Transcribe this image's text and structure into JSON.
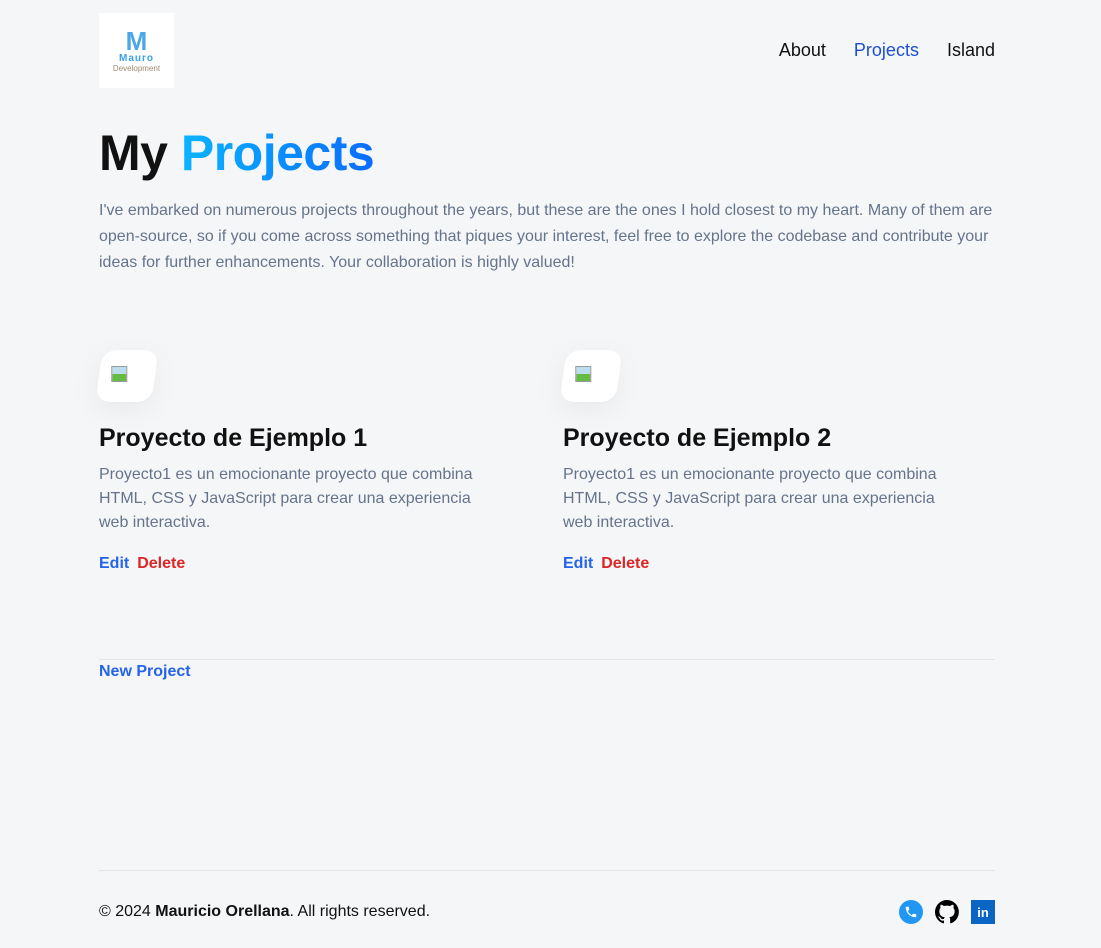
{
  "logo": {
    "mark": "M",
    "line1": "Mauro",
    "line2": "Development"
  },
  "nav": [
    {
      "label": "About"
    },
    {
      "label": "Projects"
    },
    {
      "label": "Island"
    }
  ],
  "title": {
    "prefix": "My",
    "accent": "Projects"
  },
  "intro": "I've embarked on numerous projects throughout the years, but these are the ones I hold closest to my heart. Many of them are open-source, so if you come across something that piques your interest, feel free to explore the codebase and contribute your ideas for further enhancements. Your collaboration is highly valued!",
  "projects": [
    {
      "title": "Proyecto de Ejemplo 1",
      "description": "Proyecto1 es un emocionante proyecto que combina HTML, CSS y JavaScript para crear una experiencia web interactiva.",
      "edit": "Edit",
      "delete": "Delete"
    },
    {
      "title": "Proyecto de Ejemplo 2",
      "description": "Proyecto1 es un emocionante proyecto que combina HTML, CSS y JavaScript para crear una experiencia web interactiva.",
      "edit": "Edit",
      "delete": "Delete"
    }
  ],
  "new_project": "New Project",
  "footer": {
    "prefix": "© 2024 ",
    "name": "Mauricio Orellana",
    "suffix": ". All rights reserved.",
    "icons": [
      "phone-icon",
      "github-icon",
      "linkedin-icon"
    ],
    "linkedin_text": "in"
  }
}
